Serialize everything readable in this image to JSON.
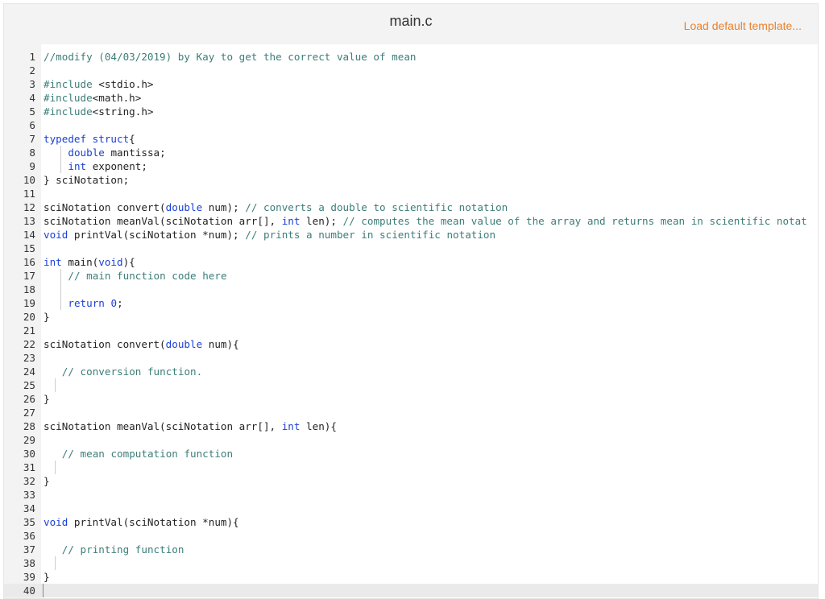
{
  "header": {
    "file_name": "main.c",
    "template_link": "Load default template..."
  },
  "colors": {
    "keyword": "#1b41d6",
    "comment": "#3c7d78",
    "text": "#222222",
    "template_link": "#e8812e",
    "gutter_bg": "#f3f3f3"
  },
  "editor": {
    "active_line": 40,
    "lines": [
      {
        "n": "1",
        "indent": 0,
        "tokens": [
          [
            "c",
            "//modify (04/03/2019) by Kay to get the correct value of mean"
          ]
        ]
      },
      {
        "n": "2",
        "indent": 0,
        "tokens": []
      },
      {
        "n": "3",
        "indent": 0,
        "tokens": [
          [
            "c",
            "#include "
          ],
          [
            "p",
            "<stdio.h>"
          ]
        ]
      },
      {
        "n": "4",
        "indent": 0,
        "tokens": [
          [
            "c",
            "#include"
          ],
          [
            "p",
            "<math.h>"
          ]
        ]
      },
      {
        "n": "5",
        "indent": 0,
        "tokens": [
          [
            "c",
            "#include"
          ],
          [
            "p",
            "<string.h>"
          ]
        ]
      },
      {
        "n": "6",
        "indent": 0,
        "tokens": []
      },
      {
        "n": "7",
        "indent": 0,
        "tokens": [
          [
            "k",
            "typedef struct"
          ],
          [
            "p",
            "{"
          ]
        ]
      },
      {
        "n": "8",
        "indent": 4,
        "guide": true,
        "tokens": [
          [
            "k",
            "double"
          ],
          [
            "p",
            " mantissa;"
          ]
        ]
      },
      {
        "n": "9",
        "indent": 4,
        "guide": true,
        "tokens": [
          [
            "k",
            "int"
          ],
          [
            "p",
            " exponent;"
          ]
        ]
      },
      {
        "n": "10",
        "indent": 0,
        "tokens": [
          [
            "p",
            "} sciNotation;"
          ]
        ]
      },
      {
        "n": "11",
        "indent": 0,
        "tokens": []
      },
      {
        "n": "12",
        "indent": 0,
        "tokens": [
          [
            "p",
            "sciNotation convert("
          ],
          [
            "k",
            "double"
          ],
          [
            "p",
            " num); "
          ],
          [
            "c",
            "// converts a double to scientific notation"
          ]
        ]
      },
      {
        "n": "13",
        "indent": 0,
        "tokens": [
          [
            "p",
            "sciNotation meanVal(sciNotation arr[], "
          ],
          [
            "k",
            "int"
          ],
          [
            "p",
            " len); "
          ],
          [
            "c",
            "// computes the mean value of the array and returns mean in scientific notat"
          ]
        ]
      },
      {
        "n": "14",
        "indent": 0,
        "tokens": [
          [
            "k",
            "void"
          ],
          [
            "p",
            " printVal(sciNotation *num); "
          ],
          [
            "c",
            "// prints a number in scientific notation"
          ]
        ]
      },
      {
        "n": "15",
        "indent": 0,
        "tokens": []
      },
      {
        "n": "16",
        "indent": 0,
        "tokens": [
          [
            "k",
            "int"
          ],
          [
            "p",
            " main("
          ],
          [
            "k",
            "void"
          ],
          [
            "p",
            "){"
          ]
        ]
      },
      {
        "n": "17",
        "indent": 4,
        "guide": true,
        "tokens": [
          [
            "c",
            "// main function code here"
          ]
        ]
      },
      {
        "n": "18",
        "indent": 4,
        "guide": true,
        "tokens": []
      },
      {
        "n": "19",
        "indent": 4,
        "guide": true,
        "tokens": [
          [
            "k",
            "return"
          ],
          [
            "p",
            " "
          ],
          [
            "n",
            "0"
          ],
          [
            "p",
            ";"
          ]
        ]
      },
      {
        "n": "20",
        "indent": 0,
        "tokens": [
          [
            "p",
            "}"
          ]
        ]
      },
      {
        "n": "21",
        "indent": 0,
        "tokens": []
      },
      {
        "n": "22",
        "indent": 0,
        "tokens": [
          [
            "p",
            "sciNotation convert("
          ],
          [
            "k",
            "double"
          ],
          [
            "p",
            " num){"
          ]
        ]
      },
      {
        "n": "23",
        "indent": 0,
        "tokens": []
      },
      {
        "n": "24",
        "indent": 3,
        "guide": false,
        "tokens": [
          [
            "c",
            "// conversion function."
          ]
        ]
      },
      {
        "n": "25",
        "indent": 3,
        "guide": true,
        "tokens": []
      },
      {
        "n": "26",
        "indent": 0,
        "tokens": [
          [
            "p",
            "}"
          ]
        ]
      },
      {
        "n": "27",
        "indent": 0,
        "tokens": []
      },
      {
        "n": "28",
        "indent": 0,
        "tokens": [
          [
            "p",
            "sciNotation meanVal(sciNotation arr[], "
          ],
          [
            "k",
            "int"
          ],
          [
            "p",
            " len){"
          ]
        ]
      },
      {
        "n": "29",
        "indent": 0,
        "tokens": []
      },
      {
        "n": "30",
        "indent": 3,
        "guide": false,
        "tokens": [
          [
            "c",
            "// mean computation function"
          ]
        ]
      },
      {
        "n": "31",
        "indent": 3,
        "guide": true,
        "tokens": []
      },
      {
        "n": "32",
        "indent": 0,
        "tokens": [
          [
            "p",
            "}"
          ]
        ]
      },
      {
        "n": "33",
        "indent": 0,
        "tokens": []
      },
      {
        "n": "34",
        "indent": 0,
        "tokens": []
      },
      {
        "n": "35",
        "indent": 0,
        "tokens": [
          [
            "k",
            "void"
          ],
          [
            "p",
            " printVal(sciNotation *num){"
          ]
        ]
      },
      {
        "n": "36",
        "indent": 0,
        "tokens": []
      },
      {
        "n": "37",
        "indent": 3,
        "guide": false,
        "tokens": [
          [
            "c",
            "// printing function"
          ]
        ]
      },
      {
        "n": "38",
        "indent": 3,
        "guide": true,
        "tokens": []
      },
      {
        "n": "39",
        "indent": 0,
        "tokens": [
          [
            "p",
            "}"
          ]
        ]
      },
      {
        "n": "40",
        "indent": 0,
        "tokens": []
      }
    ]
  }
}
